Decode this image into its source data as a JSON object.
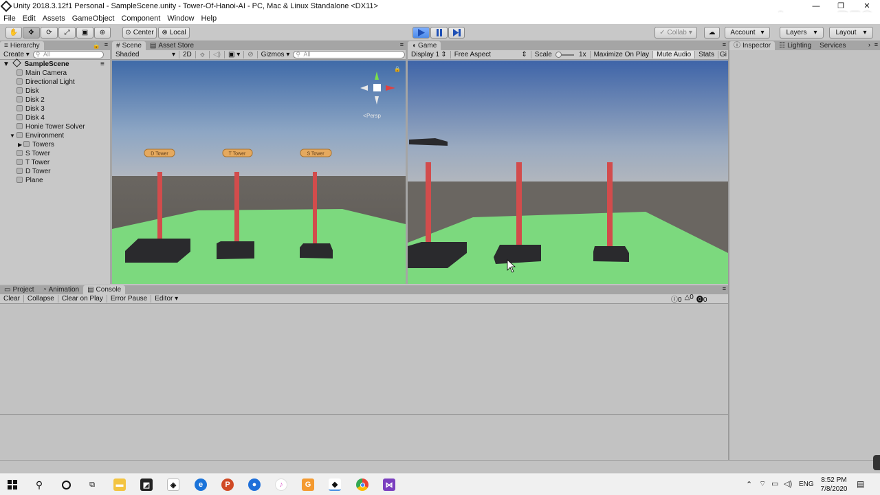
{
  "window": {
    "title": "Unity 2018.3.12f1 Personal - SampleScene.unity - Tower-Of-Hanoi-AI - PC, Mac & Linux Standalone <DX11>",
    "watermark": "ApowerREC",
    "minimize": "—",
    "restore": "❐",
    "close": "✕"
  },
  "menu": [
    "File",
    "Edit",
    "Assets",
    "GameObject",
    "Component",
    "Window",
    "Help"
  ],
  "toolbar": {
    "tools": [
      "hand-tool",
      "move-tool",
      "rotate-tool",
      "scale-tool",
      "rect-tool",
      "transform-tool"
    ],
    "pivot": "Center",
    "space": "Local",
    "collab": "Collab",
    "account": "Account",
    "layers": "Layers",
    "layout": "Layout"
  },
  "hierarchy": {
    "tab": "Hierarchy",
    "create": "Create",
    "search_placeholder": "All",
    "scene": "SampleScene",
    "items": [
      "Main Camera",
      "Directional Light",
      "Disk",
      "Disk 2",
      "Disk 3",
      "Disk 4",
      "Honie Tower Solver",
      "Environment",
      "Towers",
      "S Tower",
      "T Tower",
      "D Tower",
      "Plane"
    ]
  },
  "scene": {
    "tabs": [
      "Scene",
      "Asset Store"
    ],
    "shading": "Shaded",
    "mode2d": "2D",
    "gizmos": "Gizmos",
    "search_placeholder": "All",
    "persp": "Persp",
    "tower_labels": [
      "D Tower",
      "T Tower",
      "S Tower"
    ]
  },
  "game": {
    "tab": "Game",
    "display": "Display 1",
    "aspect": "Free Aspect",
    "scale_label": "Scale",
    "scale_value": "1x",
    "maximize": "Maximize On Play",
    "mute": "Mute Audio",
    "stats": "Stats",
    "gizmos": "Gi"
  },
  "bottom": {
    "tabs": [
      "Project",
      "Animation",
      "Console"
    ],
    "buttons": [
      "Clear",
      "Collapse",
      "Clear on Play",
      "Error Pause",
      "Editor"
    ],
    "counts": [
      "0",
      "0",
      "0"
    ]
  },
  "inspector": {
    "tabs": [
      "Inspector",
      "Lighting",
      "Services"
    ]
  },
  "taskbar": {
    "lang": "ENG",
    "time": "8:52 PM",
    "date": "7/8/2020"
  }
}
